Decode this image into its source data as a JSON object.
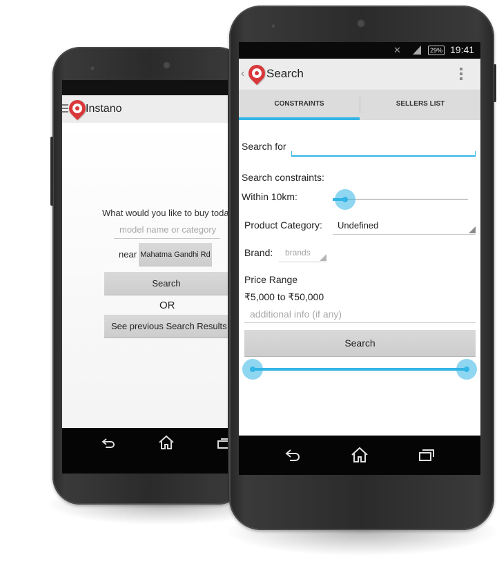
{
  "back_phone": {
    "app_title": "Instano",
    "prompt": "What would you like to buy today",
    "search_placeholder": "model name or category",
    "near_label": "near",
    "location_value": "Mahatma Gandhi Rd",
    "search_button": "Search",
    "or_label": "OR",
    "previous_results_button": "See previous Search Results",
    "nav": {
      "back": "back-icon",
      "home": "home-icon",
      "recents": "recents-icon"
    }
  },
  "front_phone": {
    "status_bar": {
      "battery": "29%",
      "time": "19:41"
    },
    "action_bar": {
      "title": "Search"
    },
    "tabs": [
      {
        "label": "CONSTRAINTS",
        "active": true
      },
      {
        "label": "SELLERS LIST",
        "active": false
      }
    ],
    "search_for_label": "Search for",
    "search_for_value": "",
    "constraints_heading": "Search constraints:",
    "distance_label": "Within 10km:",
    "distance_slider_fraction": 0.09,
    "category_label": "Product Category:",
    "category_value": "Undefined",
    "brand_label": "Brand:",
    "brand_placeholder": "brands",
    "price_range_label": "Price Range",
    "price_range_value": "₹5,000 to ₹50,000",
    "price_range_fraction": [
      0.0,
      1.0
    ],
    "additional_info_placeholder": "additional info (if any)",
    "search_button": "Search",
    "nav": {
      "back": "back-icon",
      "home": "home-icon",
      "recents": "recents-icon"
    }
  },
  "colors": {
    "accent": "#33b5e5",
    "logo_red": "#d9383a",
    "navbar": "#050505"
  }
}
